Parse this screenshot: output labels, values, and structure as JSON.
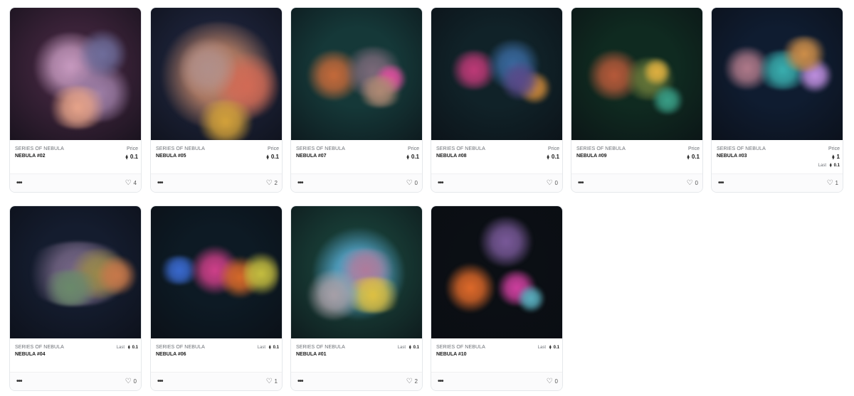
{
  "labels": {
    "price": "Price",
    "last": "Last",
    "more_icon": "•••",
    "heart_icon": "♡",
    "eth_icon": "⧫"
  },
  "cards": [
    {
      "collection": "SERIES OF NEBULA",
      "name": "NEBULA #02",
      "price": "0.1",
      "last": "",
      "likes": "4",
      "bg": "#3a2238",
      "blobs": [
        "#c79ac0",
        "#9e7fa7",
        "#e7a48a",
        "#6f6e9c"
      ]
    },
    {
      "collection": "SERIES OF NEBULA",
      "name": "NEBULA #05",
      "price": "0.1",
      "last": "",
      "likes": "2",
      "bg": "#1c2238",
      "blobs": [
        "#c98a6a",
        "#d26a55",
        "#b08f8a",
        "#d4a23a"
      ]
    },
    {
      "collection": "SERIES OF NEBULA",
      "name": "NEBULA #07",
      "price": "0.1",
      "last": "",
      "likes": "0",
      "bg": "#153838",
      "blobs": [
        "#c66a3a",
        "#7c6a7a",
        "#e24fa0",
        "#b08a74"
      ]
    },
    {
      "collection": "SERIES OF NEBULA",
      "name": "NEBULA #08",
      "price": "0.1",
      "last": "",
      "likes": "0",
      "bg": "#102228",
      "blobs": [
        "#c03a78",
        "#3a6aa0",
        "#d08a3a",
        "#5a4a8a"
      ]
    },
    {
      "collection": "SERIES OF NEBULA",
      "name": "NEBULA #09",
      "price": "0.1",
      "last": "",
      "likes": "0",
      "bg": "#0f2a20",
      "blobs": [
        "#b85a3a",
        "#6a7a3a",
        "#e0b040",
        "#3aa088"
      ]
    },
    {
      "collection": "SERIES OF NEBULA",
      "name": "NEBULA #03",
      "price": "1",
      "last": "0.1",
      "likes": "1",
      "bg": "#0f1c30",
      "blobs": [
        "#b07a8a",
        "#3ab0b0",
        "#c090e0",
        "#d0904a"
      ]
    },
    {
      "collection": "SERIES OF NEBULA",
      "name": "NEBULA #04",
      "price": "",
      "last": "0.1",
      "likes": "0",
      "bg": "#141c2e",
      "blobs": [
        "#7a6a8a",
        "#9a8a4a",
        "#c8784a",
        "#6a8a6a"
      ]
    },
    {
      "collection": "SERIES OF NEBULA",
      "name": "NEBULA #06",
      "price": "",
      "last": "0.1",
      "likes": "1",
      "bg": "#0d1a24",
      "blobs": [
        "#3a6ad0",
        "#d0408a",
        "#d86a2a",
        "#c8c040"
      ]
    },
    {
      "collection": "SERIES OF NEBULA",
      "name": "NEBULA #01",
      "price": "",
      "last": "0.1",
      "likes": "2",
      "bg": "#173a34",
      "blobs": [
        "#5ab0d8",
        "#b07a9a",
        "#e0c040",
        "#a8a0a8"
      ]
    },
    {
      "collection": "SERIES OF NEBULA",
      "name": "NEBULA #10",
      "price": "",
      "last": "0.1",
      "likes": "0",
      "bg": "#0b0f14",
      "blobs": [
        "#7a5a9a",
        "#e06a2a",
        "#d040a0",
        "#5ab0c0"
      ]
    }
  ]
}
